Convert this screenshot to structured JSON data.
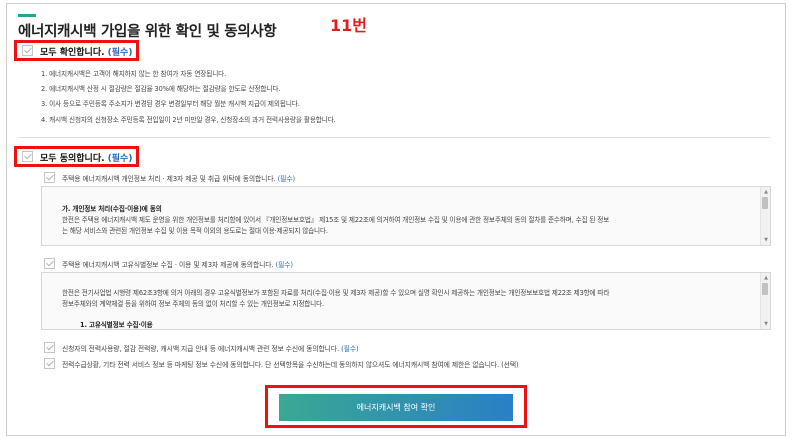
{
  "header": {
    "title": "에너지캐시백 가입을 위한 확인 및 동의사항",
    "step_label": "11번"
  },
  "section1": {
    "agree_all_label": "모두 확인합니다.",
    "required_tag": "(필수)",
    "notes": [
      "1. 에너지캐시백은 고객이 해지하지 않는 한 참여가 자동 연장됩니다.",
      "2. 에너지캐시백 산정 시 절감량은 절감율 30%에 해당하는 절감량을 한도로 산정합니다.",
      "3. 이사 등으로 주민등록 주소지가 변경된 경우 변경일부터 해당 월분 캐시백 지급이 제외됩니다.",
      "4. 캐시백 신청자의 신청장소 주민등록 전입일이 2년 미만일 경우, 신청장소의 과거 전력사용량을 활용합니다."
    ]
  },
  "section2": {
    "agree_all_label": "모두 동의합니다.",
    "required_tag": "(필수)",
    "items": [
      {
        "text": "주택용 에너지캐시백 개인정보 처리 · 제3자 제공 및 취급 위탁에 동의합니다.",
        "tag": "(필수)"
      },
      {
        "text": "주택용 에너지캐시백 고유식별정보 수집 · 이용 및 제3자 제공에 동의합니다.",
        "tag": "(필수)"
      },
      {
        "text": "신청자의 전력사용량, 절감 전력량, 캐시백 지급 안내 등 에너지캐시백 관련 정보 수신에 동의합니다.",
        "tag": "(필수)"
      },
      {
        "text": "전력수급상황, 기타 전력 서비스 정보 등 마케팅 정보 수신에 동의합니다. 단 선택항목을 수신하는데 동의하지 않으셔도 에너지캐시백 참여에 제한은 없습니다. (선택)",
        "tag": ""
      }
    ],
    "box1": {
      "heading": "가. 개인정보 처리(수집·이용)에 동의",
      "line1": "한전은 주택용 에너지캐시백 제도 운영을 위한 개인정보를 처리함에 있어서 『개인정보보호법』 제15조 및 제22조에 의거하여 개인정보 수집 및 이용에 관한 정보주체의 동의 절차를 준수하며, 수집 된 정보",
      "line2": "는 해당 서비스와 관련된 개인정보 수집 및 이용 목적 이외의 용도로는 절대 이용·제공되지 않습니다."
    },
    "box2": {
      "line1": "한전은 전기사업법 시행령 제62조3항에 의거 아래의 경우 고유식별정보가 포함된 자료를 처리(수집·이용 및 제3자 제공)할 수 있으며 실명 확인시 제공하는 개인정보는 개인정보보호법 제22조 제3항에 따라",
      "line2": "정보주체와의 계약체결 등을 위하여 정보 주체의 동의 없이 처리할 수 있는 개인정보로 지정합니다.",
      "sub_heading": "1. 고유식별정보 수집·이용"
    }
  },
  "submit": {
    "label": "에너지캐시백 참여 확인"
  },
  "colors": {
    "accent_red": "#e11111",
    "required_blue": "#2d6ab4",
    "button_gradient_start": "#3aa892",
    "button_gradient_end": "#2a7fc6"
  }
}
